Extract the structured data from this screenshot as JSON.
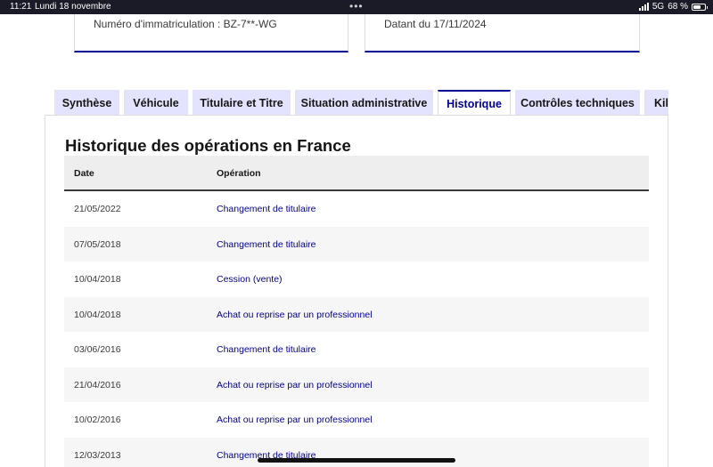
{
  "status_bar": {
    "time": "11:21",
    "date": "Lundi 18 novembre",
    "dots": "•••",
    "network": "5G",
    "battery": "68 %",
    "battery_level": 0.68
  },
  "cards": [
    {
      "text": "Numéro d'immatriculation : BZ-7**-WG"
    },
    {
      "text": "Datant du 17/11/2024"
    }
  ],
  "tabs": [
    {
      "label": "Synthèse",
      "active": false
    },
    {
      "label": "Véhicule",
      "active": false
    },
    {
      "label": "Titulaire et Titre",
      "active": false
    },
    {
      "label": "Situation administrative",
      "active": false
    },
    {
      "label": "Historique",
      "active": true
    },
    {
      "label": "Contrôles techniques",
      "active": false
    },
    {
      "label": "Kilométrage",
      "active": false
    }
  ],
  "panel": {
    "title": "Historique des opérations en France"
  },
  "table": {
    "columns": [
      "Date",
      "Opération"
    ],
    "rows": [
      {
        "date": "21/05/2022",
        "operation": "Changement de titulaire"
      },
      {
        "date": "07/05/2018",
        "operation": "Changement de titulaire"
      },
      {
        "date": "10/04/2018",
        "operation": "Cession (vente)"
      },
      {
        "date": "10/04/2018",
        "operation": "Achat ou reprise par un professionnel"
      },
      {
        "date": "03/06/2016",
        "operation": "Changement de titulaire"
      },
      {
        "date": "21/04/2016",
        "operation": "Achat ou reprise par un professionnel"
      },
      {
        "date": "10/02/2016",
        "operation": "Achat ou reprise par un professionnel"
      },
      {
        "date": "12/03/2013",
        "operation": "Changement de titulaire"
      }
    ]
  },
  "colors": {
    "accent": "#000091",
    "tab_bg": "#e3e3fd",
    "statusbar_bg": "#1b1b27"
  }
}
